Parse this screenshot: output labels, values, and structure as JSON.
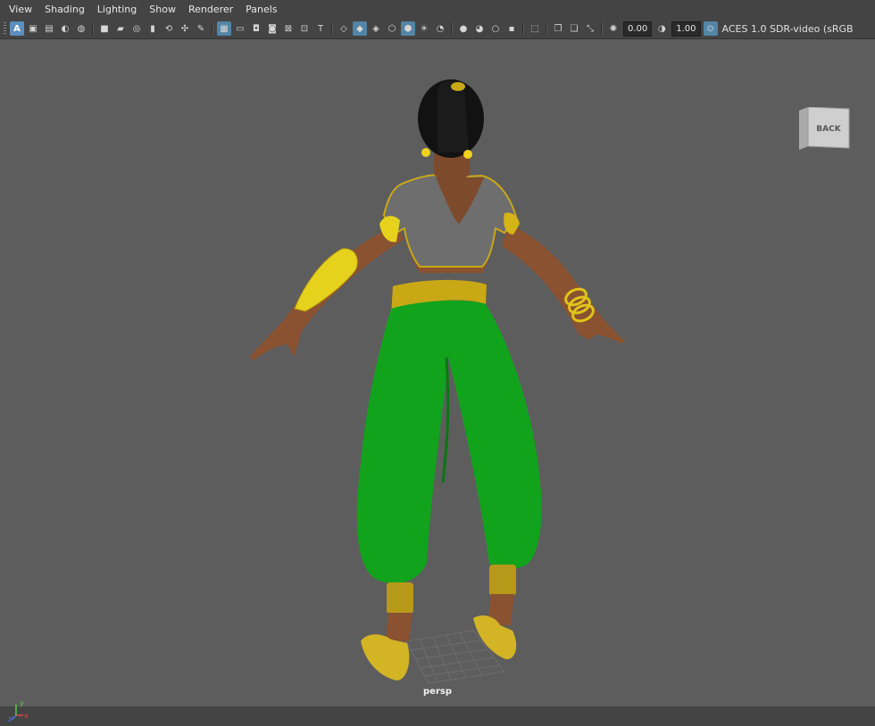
{
  "menu": [
    "View",
    "Shading",
    "Lighting",
    "Show",
    "Renderer",
    "Panels"
  ],
  "toolbar": {
    "groups": [
      [
        "select-camera-icon",
        "camera-attributes-icon",
        "bookmarks-icon",
        "image-plane-icon",
        "twod-pan-icon",
        "grease-pencil-icon"
      ],
      [
        "camera-icon",
        "camera-lock-icon",
        "film-gate-icon",
        "resolution-gate-icon",
        "gate-mask-icon",
        "field-chart-icon",
        "safe-action-icon",
        "safe-title-icon"
      ],
      [
        "grid-icon",
        "wireframe-icon",
        "smooth-shade-icon",
        "textured-icon",
        "lighting-icon",
        "shadows-icon",
        "ambient-occlusion-icon"
      ],
      [
        "isolate-icon",
        "xray-icon",
        "xray-joints-icon",
        "backface-icon"
      ]
    ],
    "exposure": "0.00",
    "gamma": "1.00",
    "color_space": "ACES 1.0 SDR-video (sRGB"
  },
  "viewport": {
    "camera_label": "persp",
    "viewcube_face": "BACK",
    "axis": {
      "x": "x",
      "y": "y",
      "z": "z"
    }
  },
  "colors": {
    "viewport_bg": "#5d5d5d",
    "skin": "#8a5230",
    "pants": "#12a31c",
    "gold": "#d4b417",
    "top": "#6e6e6e",
    "hair": "#111111"
  }
}
